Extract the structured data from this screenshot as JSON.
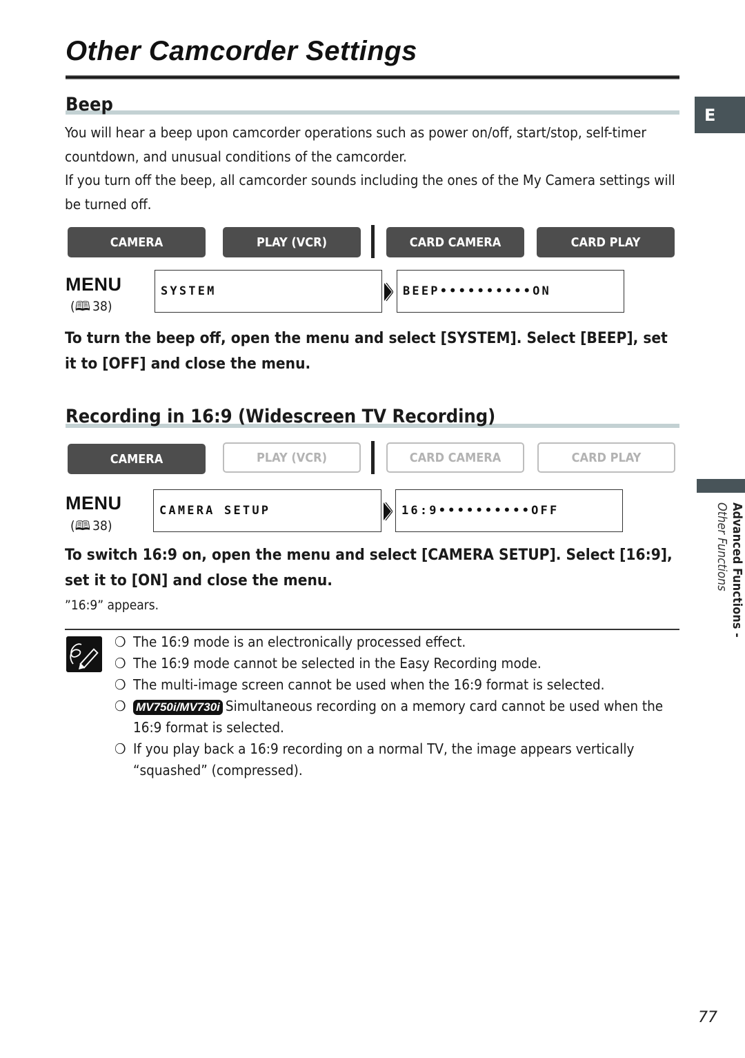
{
  "page": {
    "title": "Other Camcorder Settings",
    "language_tab": "E",
    "page_number": "77",
    "side_section": {
      "chapter": "Advanced Functions -",
      "subsection": "Other Functions"
    }
  },
  "beep": {
    "heading": "Beep",
    "paragraph1": "You will hear a beep upon camcorder operations such as power on/off, start/stop, self-timer countdown, and unusual conditions of the camcorder.",
    "paragraph2": "If you turn off the beep, all camcorder sounds including the ones of the My Camera settings will be turned off.",
    "modes": [
      {
        "label": "CAMERA",
        "active": true
      },
      {
        "label": "PLAY (VCR)",
        "active": true
      },
      {
        "label": "CARD CAMERA",
        "active": true
      },
      {
        "label": "CARD PLAY",
        "active": true
      }
    ],
    "menu": {
      "label": "MENU",
      "ref_icon": "book-icon",
      "ref_page": "38",
      "submenu": "SYSTEM",
      "setting": "BEEP••••••••••ON"
    },
    "instruction": "To turn the beep off, open the menu and select [SYSTEM]. Select [BEEP], set it to [OFF] and close the menu."
  },
  "widescreen": {
    "heading": "Recording in 16:9 (Widescreen TV Recording)",
    "modes": [
      {
        "label": "CAMERA",
        "active": true
      },
      {
        "label": "PLAY (VCR)",
        "active": false
      },
      {
        "label": "CARD CAMERA",
        "active": false
      },
      {
        "label": "CARD PLAY",
        "active": false
      }
    ],
    "menu": {
      "label": "MENU",
      "ref_icon": "book-icon",
      "ref_page": "38",
      "submenu": "CAMERA SETUP",
      "setting": "16:9••••••••••OFF"
    },
    "instruction": "To switch 16:9 on, open the menu and select [CAMERA SETUP]. Select [16:9], set it to [ON] and close the menu.",
    "result": "”16:9” appears."
  },
  "notes": {
    "icon": "pencil-note-icon",
    "bullet": "❍",
    "items": [
      {
        "badge": "",
        "text": "The 16:9 mode is an electronically processed effect."
      },
      {
        "badge": "",
        "text": "The 16:9 mode cannot be selected in the Easy Recording mode."
      },
      {
        "badge": "",
        "text": "The multi-image screen cannot be used when the 16:9 format is selected."
      },
      {
        "badge": "MV750i/MV730i",
        "text": "Simultaneous recording on a memory card cannot be used when the 16:9 format is selected."
      },
      {
        "badge": "",
        "text": "If you play back a 16:9 recording on a normal TV, the image appears vertically “squashed” (compressed)."
      }
    ]
  }
}
